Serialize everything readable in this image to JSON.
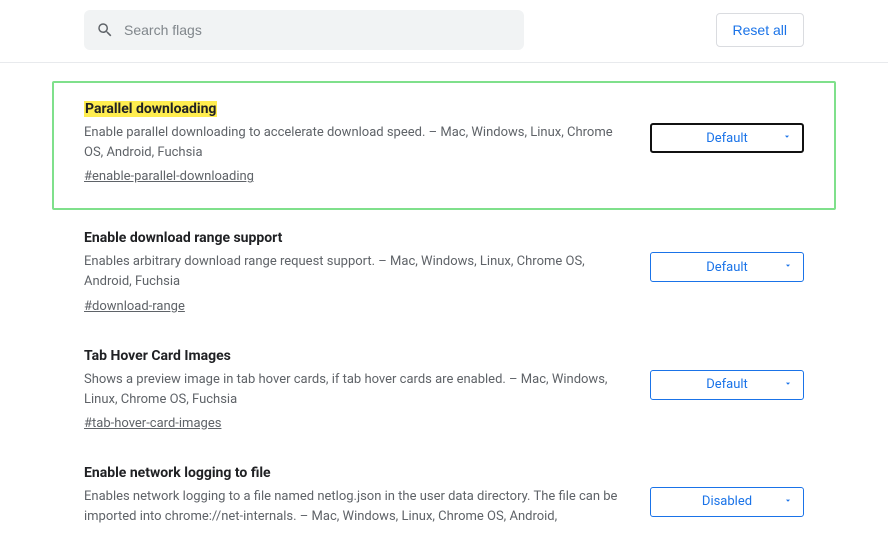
{
  "search": {
    "placeholder": "Search flags"
  },
  "reset_label": "Reset all",
  "flags": [
    {
      "title": "Parallel downloading",
      "desc": "Enable parallel downloading to accelerate download speed. – Mac, Windows, Linux, Chrome OS, Android, Fuchsia",
      "anchor": "#enable-parallel-downloading",
      "value": "Default"
    },
    {
      "title": "Enable download range support",
      "desc": "Enables arbitrary download range request support. – Mac, Windows, Linux, Chrome OS, Android, Fuchsia",
      "anchor": "#download-range",
      "value": "Default"
    },
    {
      "title": "Tab Hover Card Images",
      "desc": "Shows a preview image in tab hover cards, if tab hover cards are enabled. – Mac, Windows, Linux, Chrome OS, Fuchsia",
      "anchor": "#tab-hover-card-images",
      "value": "Default"
    },
    {
      "title": "Enable network logging to file",
      "desc": "Enables network logging to a file named netlog.json in the user data directory. The file can be imported into chrome://net-internals. – Mac, Windows, Linux, Chrome OS, Android,",
      "anchor": "",
      "value": "Disabled"
    }
  ]
}
